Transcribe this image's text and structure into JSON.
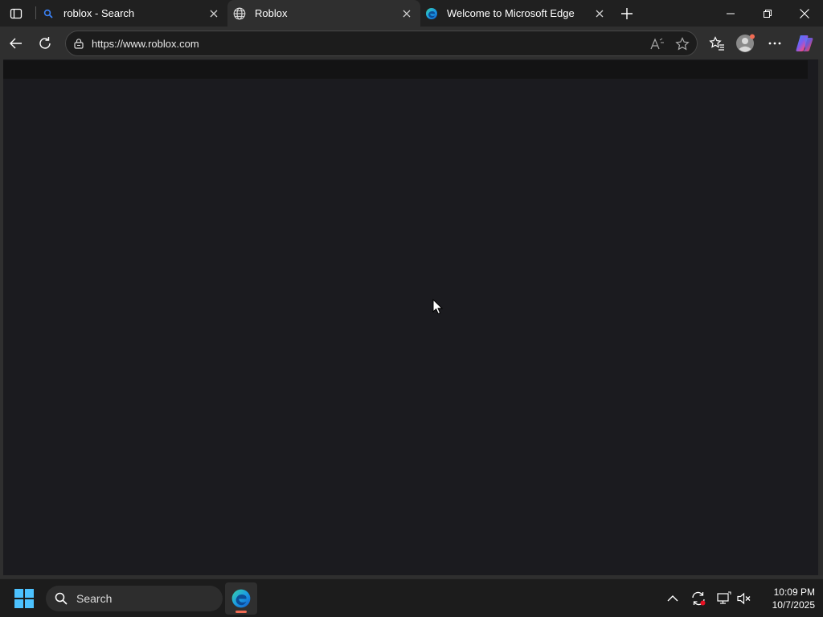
{
  "browser": {
    "tabs": [
      {
        "title": "roblox - Search",
        "icon": "search-icon",
        "active": false
      },
      {
        "title": "Roblox",
        "icon": "globe-icon",
        "active": true
      },
      {
        "title": "Welcome to Microsoft Edge",
        "icon": "edge-icon",
        "active": false
      }
    ],
    "address_url": "https://www.roblox.com"
  },
  "taskbar": {
    "search_label": "Search",
    "clock_time": "10:09 PM",
    "clock_date": "10/7/2025"
  },
  "colors": {
    "page_bg": "#1b1b1f",
    "chrome_bg": "#202020",
    "toolbar_bg": "#2f2f2f",
    "accent": "#f06b53"
  }
}
